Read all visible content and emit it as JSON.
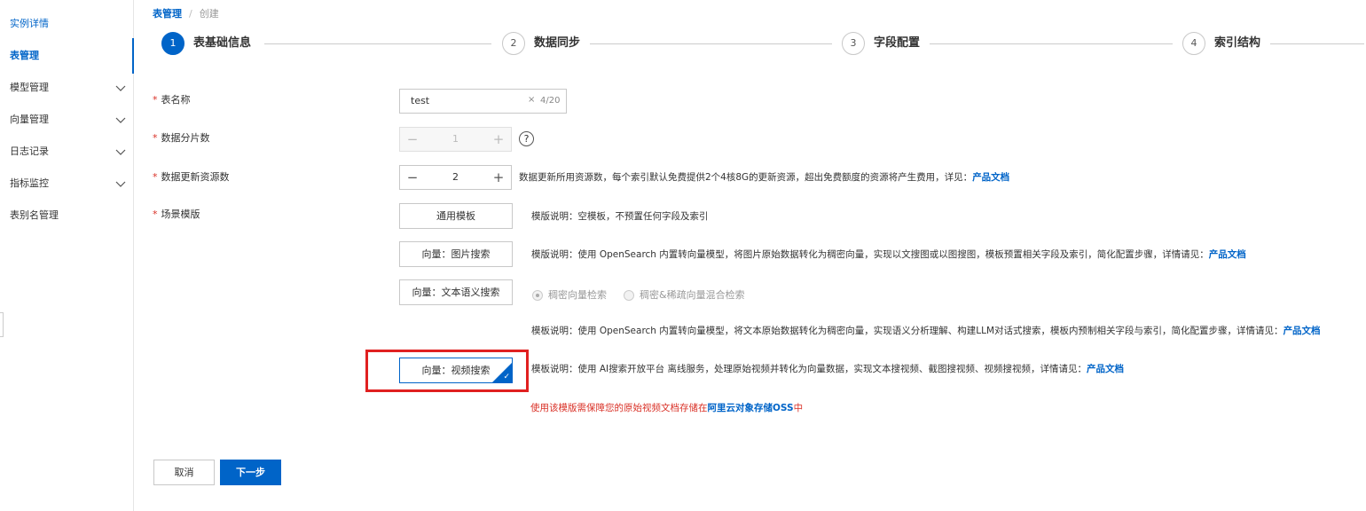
{
  "sidebar": {
    "items": [
      {
        "label": "实例详情",
        "expandable": false
      },
      {
        "label": "表管理",
        "expandable": false,
        "active": true
      },
      {
        "label": "模型管理",
        "expandable": true
      },
      {
        "label": "向量管理",
        "expandable": true
      },
      {
        "label": "日志记录",
        "expandable": true
      },
      {
        "label": "指标监控",
        "expandable": true
      },
      {
        "label": "表别名管理",
        "expandable": false
      }
    ]
  },
  "breadcrumb": {
    "root": "表管理",
    "separator": "/",
    "current": "创建"
  },
  "steps": [
    {
      "number": "1",
      "label": "表基础信息",
      "active": true
    },
    {
      "number": "2",
      "label": "数据同步",
      "active": false
    },
    {
      "number": "3",
      "label": "字段配置",
      "active": false
    },
    {
      "number": "4",
      "label": "索引结构",
      "active": false
    }
  ],
  "form": {
    "table_name": {
      "required_mark": "*",
      "label": "表名称",
      "value": "test",
      "clear": "×",
      "count": "4/20"
    },
    "shards": {
      "required_mark": "*",
      "label": "数据分片数",
      "minus": "−",
      "value": "1",
      "plus": "+",
      "help": "?"
    },
    "resources": {
      "required_mark": "*",
      "label": "数据更新资源数",
      "minus": "−",
      "value": "2",
      "plus": "+",
      "desc": "数据更新所用资源数，每个索引默认免费提供2个4核8G的更新资源，超出免费额度的资源将产生费用，详见：",
      "link": "产品文档"
    },
    "template": {
      "required_mark": "*",
      "label": "场景模版",
      "options": [
        {
          "label": "通用模板",
          "desc": "模版说明：空模板，不预置任何字段及索引",
          "link": ""
        },
        {
          "label": "向量：图片搜索",
          "desc": "模版说明：使用 OpenSearch 内置转向量模型，将图片原始数据转化为稠密向量，实现以文搜图或以图搜图，模板预置相关字段及索引，简化配置步骤，详情请见：",
          "link": "产品文档"
        },
        {
          "label": "向量：文本语义搜索",
          "desc": "模板说明：使用 OpenSearch 内置转向量模型，将文本原始数据转化为稠密向量，实现语义分析理解、构建LLM对话式搜索，模板内预制相关字段与索引，简化配置步骤，详情请见：",
          "link": "产品文档"
        },
        {
          "label": "向量：视频搜索",
          "desc": "模板说明：使用 AI搜索开放平台 离线服务，处理原始视频并转化为向量数据，实现文本搜视频、截图搜视频、视频搜视频，详情请见：",
          "link": "产品文档",
          "selected": true
        }
      ],
      "radios": [
        {
          "label": "稠密向量检索",
          "checked": true
        },
        {
          "label": "稠密&稀疏向量混合检索",
          "checked": false
        }
      ],
      "warning": {
        "text": "使用该模版需保障您的原始视频文档存储在",
        "link": "阿里云对象存储OSS",
        "suffix": "中"
      }
    }
  },
  "footer": {
    "cancel": "取消",
    "next": "下一步"
  },
  "colors": {
    "accent": "#0064c8",
    "danger": "#d93026",
    "highlight": "#e02020"
  }
}
